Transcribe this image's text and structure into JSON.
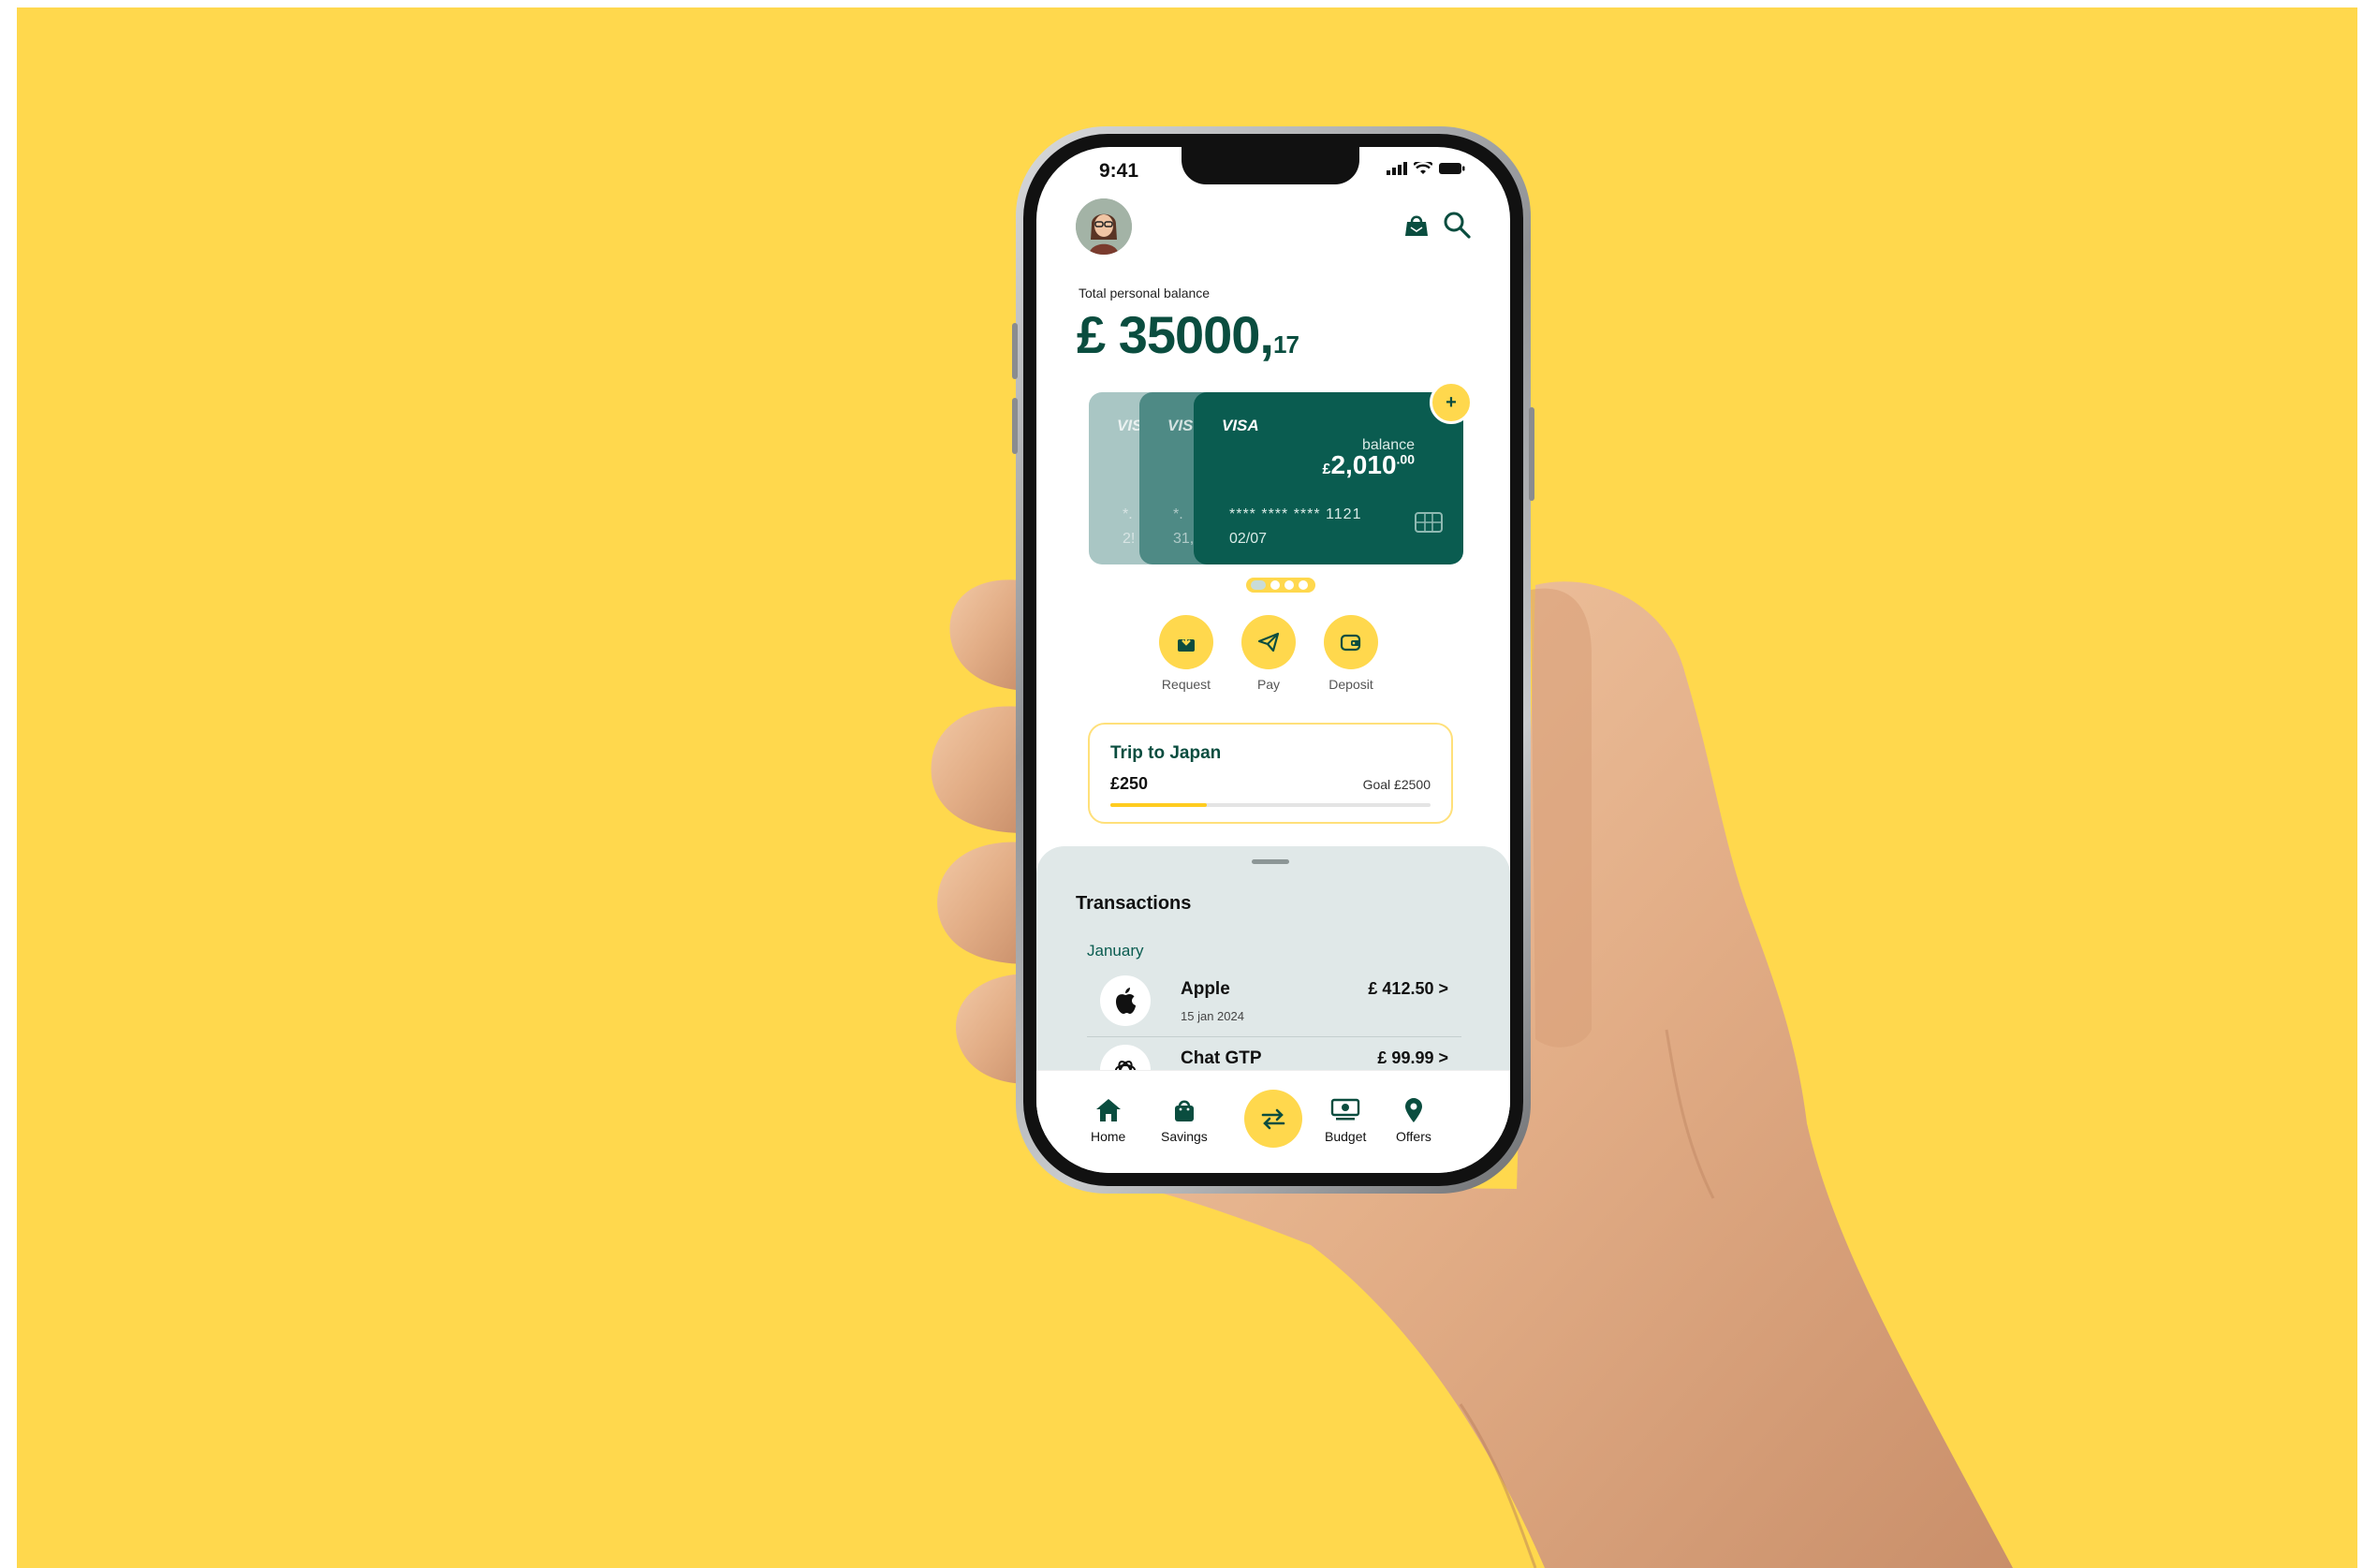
{
  "status_bar": {
    "time": "9:41"
  },
  "header": {
    "balance_label": "Total personal balance",
    "balance_main": "£ 35000,",
    "balance_cents": "17"
  },
  "cards": {
    "front": {
      "brand": "VISA",
      "balance_label": "balance",
      "balance_currency": "£",
      "balance_amount": "2,010",
      "balance_decimals": ".00",
      "number": "**** **** **** 1121",
      "expiry": "02/07"
    },
    "back1": {
      "brand": "VIS",
      "number_partial": "*.",
      "expiry_partial": "31,"
    },
    "back2": {
      "brand": "VIS",
      "number_partial": "*.",
      "expiry_partial": "2!"
    },
    "add_label": "+"
  },
  "actions": [
    {
      "label": "Request",
      "icon": "request-icon"
    },
    {
      "label": "Pay",
      "icon": "send-icon"
    },
    {
      "label": "Deposit",
      "icon": "wallet-icon"
    }
  ],
  "goal": {
    "title": "Trip to Japan",
    "amount": "£250",
    "target": "Goal £2500",
    "progress": 0.3
  },
  "transactions": {
    "title": "Transactions",
    "month": "January",
    "items": [
      {
        "name": "Apple",
        "date": "15 jan 2024",
        "amount": "£ 412.50 >",
        "icon": "apple-icon"
      },
      {
        "name": "Chat GTP",
        "date": "",
        "amount": "£ 99.99 >",
        "icon": "openai-icon"
      }
    ]
  },
  "tabbar": {
    "items": [
      {
        "label": "Home",
        "icon": "home-icon"
      },
      {
        "label": "Savings",
        "icon": "savings-bag-icon"
      },
      {
        "label": "",
        "icon": "transfer-icon"
      },
      {
        "label": "Budget",
        "icon": "budget-icon"
      },
      {
        "label": "Offers",
        "icon": "location-pin-icon"
      }
    ]
  },
  "colors": {
    "background": "#FFD84D",
    "brand": "#0a4d3f",
    "accent": "#FFD84D",
    "card": "#0a5c50"
  }
}
